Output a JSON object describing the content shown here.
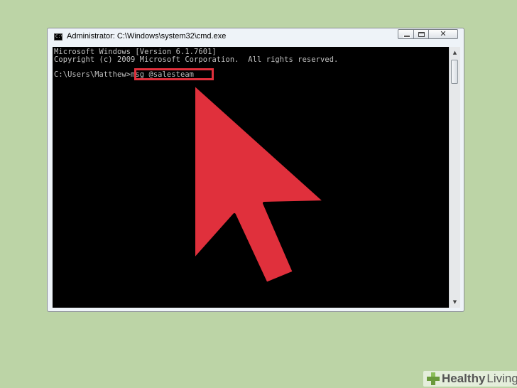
{
  "window": {
    "title": "Administrator: C:\\Windows\\system32\\cmd.exe",
    "icon": "cmd-icon",
    "controls": {
      "minimize": "minimize-icon",
      "maximize": "maximize-icon",
      "close_glyph": "✕"
    }
  },
  "console": {
    "lines": [
      "Microsoft Windows [Version 6.1.7601]",
      "Copyright (c) 2009 Microsoft Corporation.  All rights reserved.",
      "C:\\Users\\Matthew>msg @salesteam"
    ],
    "cursor": "_"
  },
  "annotation": {
    "highlight_color": "#e0303c",
    "arrow_color": "#e0303c"
  },
  "watermark": {
    "brand_a": "Healthy",
    "brand_b": "Living"
  }
}
